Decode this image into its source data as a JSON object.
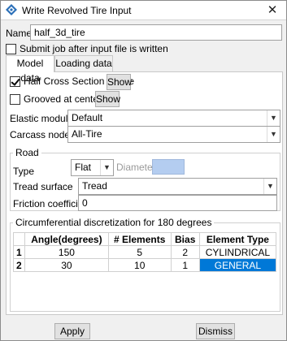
{
  "window": {
    "title": "Write Revolved Tire Input",
    "close_glyph": "✕"
  },
  "name_field": {
    "label": "Name:",
    "value": "half_3d_tire"
  },
  "submit_checkbox": {
    "label": "Submit job after input file is written",
    "checked": false
  },
  "tabs": [
    {
      "label": "Model data",
      "active": true
    },
    {
      "label": "Loading data",
      "active": false
    }
  ],
  "model_data": {
    "half_cross_section": {
      "label": "Half Cross Section of Tire",
      "checked": true,
      "show_label": "Show"
    },
    "grooved": {
      "label": "Grooved at centerline",
      "checked": false,
      "show_label": "Show"
    },
    "elastic_moduli": {
      "label": "Elastic moduli",
      "value": "Default"
    },
    "carcass_node_set": {
      "label": "Carcass node set",
      "value": "All-Tire"
    },
    "road": {
      "title": "Road",
      "type_label": "Type",
      "type_value": "Flat",
      "diameter_label": "Diameter",
      "tread_surface_label": "Tread surface",
      "tread_surface_value": "Tread",
      "friction_label": "Friction coefficient",
      "friction_value": "0"
    },
    "circumferential": {
      "title": "Circumferential discretization for 180 degrees",
      "columns": [
        "Angle(degrees)",
        "# Elements",
        "Bias",
        "Element Type"
      ],
      "rows": [
        {
          "index": "1",
          "angle": "150",
          "elements": "5",
          "bias": "2",
          "type": "CYLINDRICAL",
          "selected": false
        },
        {
          "index": "2",
          "angle": "30",
          "elements": "10",
          "bias": "1",
          "type": "GENERAL",
          "selected": true
        }
      ]
    }
  },
  "buttons": {
    "apply": "Apply",
    "dismiss": "Dismiss"
  },
  "colors": {
    "selection": "#0078d7",
    "diameter_field": "#b4cdf0"
  }
}
